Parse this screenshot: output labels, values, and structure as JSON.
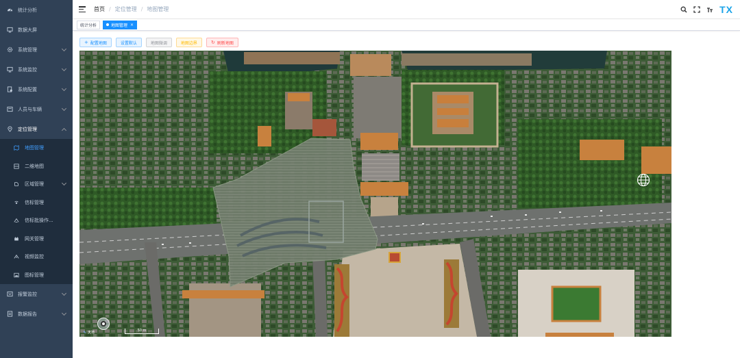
{
  "sidebar": {
    "items": [
      {
        "label": "统计分析",
        "icon": "dashboard-icon"
      },
      {
        "label": "数据大屏",
        "icon": "monitor-icon"
      },
      {
        "label": "系统管理",
        "icon": "gear-icon"
      },
      {
        "label": "系统监控",
        "icon": "monitor-icon"
      },
      {
        "label": "系统配置",
        "icon": "config-icon"
      },
      {
        "label": "人员与车辆",
        "icon": "people-icon"
      },
      {
        "label": "定位管理",
        "icon": "location-icon"
      }
    ],
    "sub_items": [
      {
        "label": "地图管理",
        "icon": "map-icon"
      },
      {
        "label": "二维地图",
        "icon": "grid-icon"
      },
      {
        "label": "区域管理",
        "icon": "region-icon"
      },
      {
        "label": "信标管理",
        "icon": "beacon-icon"
      },
      {
        "label": "信标批操作...",
        "icon": "batch-icon"
      },
      {
        "label": "网关管理",
        "icon": "gateway-icon"
      },
      {
        "label": "视频监控",
        "icon": "video-icon"
      },
      {
        "label": "图标管理",
        "icon": "image-icon"
      }
    ],
    "bottom_items": [
      {
        "label": "报警监控",
        "icon": "alarm-icon"
      },
      {
        "label": "数据报告",
        "icon": "report-icon"
      }
    ]
  },
  "breadcrumb": [
    "首页",
    "定位管理",
    "地图管理"
  ],
  "breadcrumb_sep": "/",
  "tags": {
    "first": "统计分析",
    "active": "地图管理",
    "close": "×"
  },
  "toolbar": {
    "config_map": "配置地图",
    "set_default": "设置默认",
    "map_tune": "地图微调",
    "map_border": "地图边界",
    "refresh_map": "刷新地图",
    "add_symbol": "+",
    "refresh_symbol": "↻"
  },
  "map": {
    "brand": "天地",
    "scale_label": "50 m"
  },
  "header": {
    "logo": "TX"
  },
  "colors": {
    "sidebar_bg": "#304156",
    "active": "#409eff",
    "tag_active": "#1890ff",
    "logo": "#1aa3e8"
  }
}
